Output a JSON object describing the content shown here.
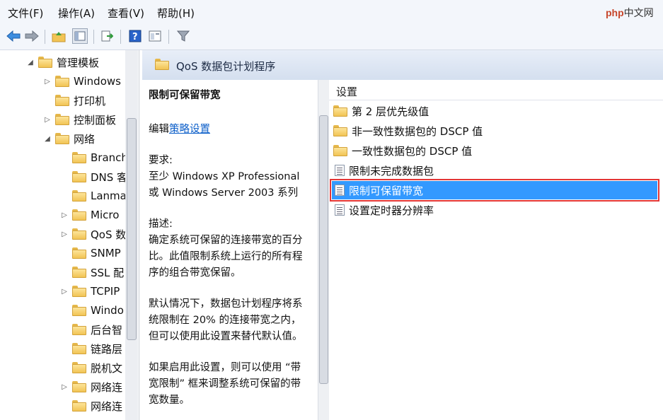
{
  "menu": [
    "文件(F)",
    "操作(A)",
    "查看(V)",
    "帮助(H)"
  ],
  "watermark": {
    "a": "php",
    "b": "中文网"
  },
  "toolbar_icons": [
    "back-arrow-icon",
    "forward-arrow-icon",
    "up-folder-icon",
    "show-hide-tree-icon",
    "export-list-icon",
    "help-icon",
    "extended-view-icon",
    "filter-icon"
  ],
  "tree": {
    "root": "管理模板",
    "items": [
      "Windows",
      "打印机",
      "控制面板",
      "网络",
      "Branch",
      "DNS 客",
      "Lanma",
      "Micro",
      "QoS 数",
      "SNMP",
      "SSL 配",
      "TCPIP",
      "Windo",
      "后台智",
      "链路层",
      "脱机文",
      "网络连",
      "网络连"
    ]
  },
  "header": {
    "title": "QoS 数据包计划程序"
  },
  "description": {
    "title": "限制可保留带宽",
    "edit_prefix": "编辑",
    "edit_link": "策略设置",
    "req_label": "要求:",
    "req_line1": "至少 Windows XP Professional",
    "req_line2": "或 Windows Server 2003 系列",
    "desc_label": "描述:",
    "p1": [
      "确定系统可保留的连接带宽的百分",
      "比。此值限制系统上运行的所有程",
      "序的组合带宽保留。"
    ],
    "p2": [
      "默认情况下，数据包计划程序将系",
      "统限制在 20% 的连接带宽之内，",
      "但可以使用此设置来替代默认值。"
    ],
    "p3": [
      "如果启用此设置，则可以使用 “带",
      "宽限制” 框来调整系统可保留的带",
      "宽数量。"
    ]
  },
  "list": {
    "column": "设置",
    "items": [
      {
        "label": "第 2 层优先级值",
        "icon": "folder-icon"
      },
      {
        "label": "非一致性数据包的 DSCP 值",
        "icon": "folder-icon"
      },
      {
        "label": "一致性数据包的 DSCP 值",
        "icon": "folder-icon"
      },
      {
        "label": "限制未完成数据包",
        "icon": "policy-icon"
      },
      {
        "label": "限制可保留带宽",
        "icon": "policy-icon",
        "selected": true
      },
      {
        "label": "设置定时器分辨率",
        "icon": "policy-icon"
      }
    ]
  }
}
